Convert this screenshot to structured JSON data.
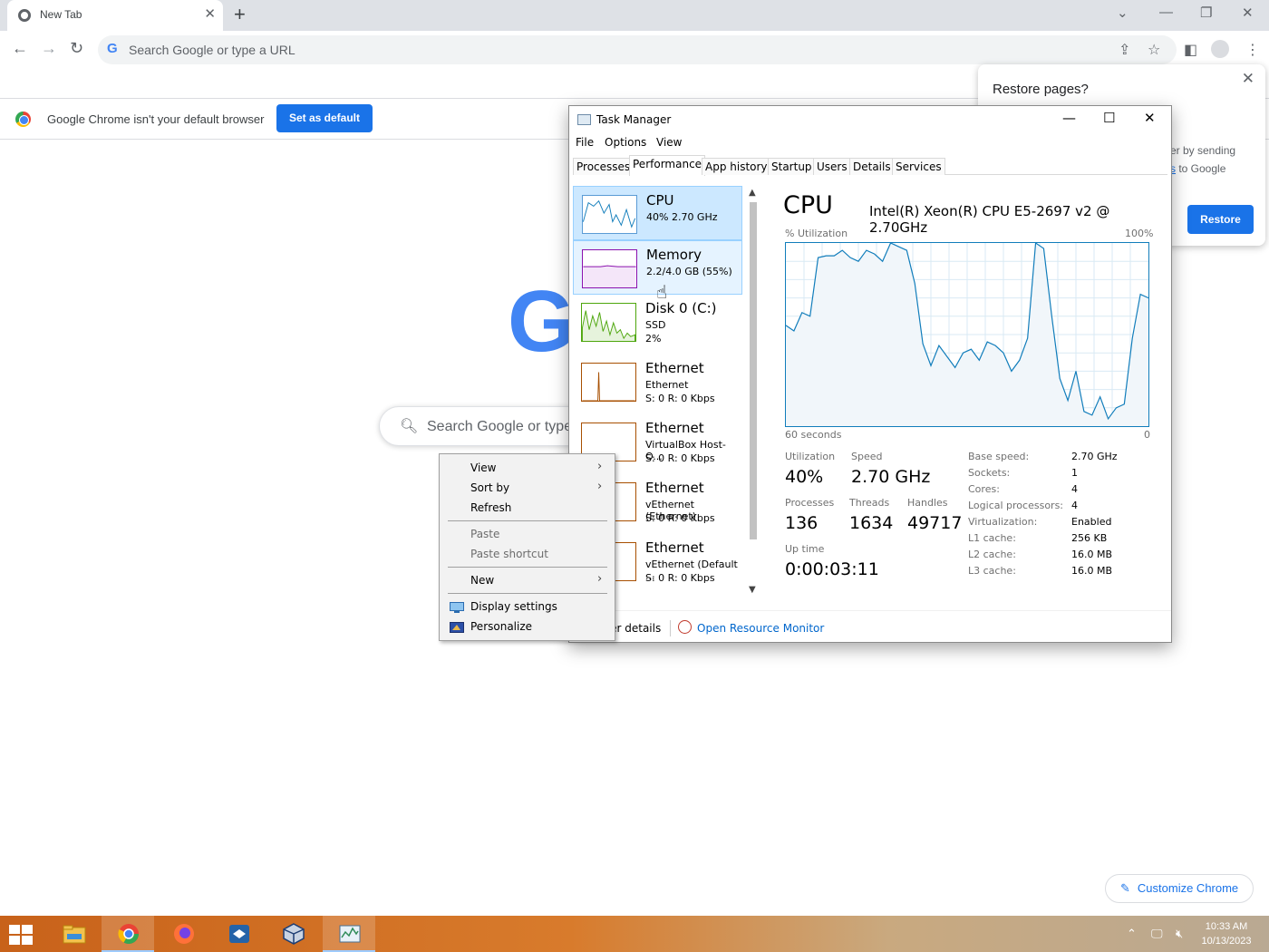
{
  "browser": {
    "tab_title": "New Tab",
    "omnibox_placeholder": "Search Google or type a URL",
    "infobar_message": "Google Chrome isn't your default browser",
    "set_default_label": "Set as default",
    "google_search_placeholder": "Search Google or type",
    "customize_label": "Customize Chrome"
  },
  "restore_popup": {
    "title": "Restore pages?",
    "text_line1": "er by sending",
    "text_link": "s",
    "text_line2": " to Google",
    "button": "Restore"
  },
  "task_manager": {
    "title": "Task Manager",
    "menu": [
      "File",
      "Options",
      "View"
    ],
    "tabs": [
      "Processes",
      "Performance",
      "App history",
      "Startup",
      "Users",
      "Details",
      "Services"
    ],
    "resources": [
      {
        "name": "CPU",
        "sub1": "40%  2.70 GHz",
        "sub2": "",
        "sub3": ""
      },
      {
        "name": "Memory",
        "sub1": "2.2/4.0 GB (55%)",
        "sub2": "",
        "sub3": ""
      },
      {
        "name": "Disk 0 (C:)",
        "sub1": "SSD",
        "sub2": "2%",
        "sub3": ""
      },
      {
        "name": "Ethernet",
        "sub1": "Ethernet",
        "sub2": "S: 0  R: 0 Kbps",
        "sub3": ""
      },
      {
        "name": "Ethernet",
        "sub1": "VirtualBox Host-O...",
        "sub2": "S: 0  R: 0 Kbps",
        "sub3": ""
      },
      {
        "name": "Ethernet",
        "sub1": "vEthernet (Ethernet)",
        "sub2": "S: 0  R: 0 Kbps",
        "sub3": ""
      },
      {
        "name": "Ethernet",
        "sub1": "vEthernet (Default ...",
        "sub2": "S: 0  R: 0 Kbps",
        "sub3": ""
      }
    ],
    "cpu": {
      "heading": "CPU",
      "model": "Intel(R) Xeon(R) CPU E5-2697 v2 @ 2.70GHz",
      "util_label": "% Utilization",
      "max_label": "100%",
      "time_label": "60 seconds",
      "min_label": "0",
      "utilization_history": [
        55,
        52,
        62,
        60,
        92,
        93,
        93,
        96,
        92,
        90,
        96,
        94,
        90,
        100,
        98,
        96,
        78,
        45,
        33,
        44,
        38,
        32,
        40,
        42,
        36,
        46,
        44,
        40,
        30,
        36,
        48,
        100,
        97,
        60,
        26,
        14,
        30,
        8,
        6,
        16,
        4,
        10,
        12,
        48,
        72,
        70
      ],
      "stats": {
        "utilization_label": "Utilization",
        "utilization": "40%",
        "speed_label": "Speed",
        "speed": "2.70 GHz",
        "processes_label": "Processes",
        "processes": "136",
        "threads_label": "Threads",
        "threads": "1634",
        "handles_label": "Handles",
        "handles": "49717",
        "uptime_label": "Up time",
        "uptime": "0:00:03:11"
      },
      "specs": [
        {
          "k": "Base speed:",
          "v": "2.70 GHz"
        },
        {
          "k": "Sockets:",
          "v": "1"
        },
        {
          "k": "Cores:",
          "v": "4"
        },
        {
          "k": "Logical processors:",
          "v": "4"
        },
        {
          "k": "Virtualization:",
          "v": "Enabled"
        },
        {
          "k": "L1 cache:",
          "v": "256 KB"
        },
        {
          "k": "L2 cache:",
          "v": "16.0 MB"
        },
        {
          "k": "L3 cache:",
          "v": "16.0 MB"
        }
      ]
    },
    "fewer_details": "ver details",
    "open_resource_monitor": "Open Resource Monitor"
  },
  "context_menu": {
    "view": "View",
    "sort_by": "Sort by",
    "refresh": "Refresh",
    "paste": "Paste",
    "paste_shortcut": "Paste shortcut",
    "new": "New",
    "display_settings": "Display settings",
    "personalize": "Personalize"
  },
  "taskbar": {
    "apps": [
      "start-icon",
      "file-explorer-icon",
      "chrome-icon",
      "firefox-icon",
      "virtualbox-manager-icon",
      "virtualbox-icon",
      "task-manager-icon"
    ],
    "time": "10:33 AM",
    "date": "10/13/2023"
  },
  "colors": {
    "chrome_blue": "#1a73e8",
    "cpu_graph": "#117dbb",
    "memory_graph": "#8b12ae",
    "disk_graph": "#4da60c",
    "ethernet_graph": "#a74f01"
  }
}
